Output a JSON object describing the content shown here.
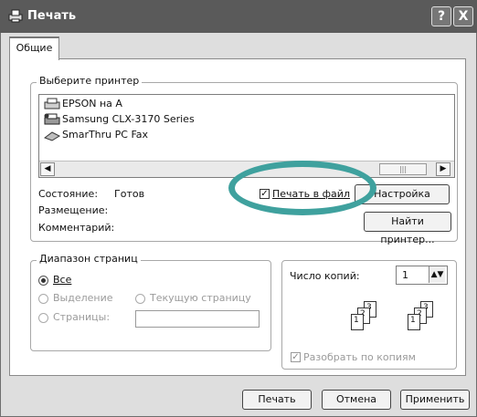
{
  "window": {
    "title": "Печать",
    "help_glyph": "?",
    "close_glyph": "X"
  },
  "tabs": [
    {
      "label": "Общие"
    }
  ],
  "printer": {
    "group_label": "Выберите принтер",
    "items": [
      {
        "name": "EPSON на А",
        "icon": "printer-icon"
      },
      {
        "name": "Samsung CLX-3170 Series",
        "icon": "default-printer-icon"
      },
      {
        "name": "SmarThru PC Fax",
        "icon": "fax-icon"
      }
    ],
    "status_label": "Состояние:",
    "status_value": "Готов",
    "location_label": "Размещение:",
    "comment_label": "Комментарий:",
    "print_to_file_label": "Печать в файл",
    "print_to_file_checked": true,
    "settings_button": "Настройка",
    "find_printer_button": "Найти принтер..."
  },
  "page_range": {
    "group_label": "Диапазон страниц",
    "all_label": "Все",
    "selection_label": "Выделение",
    "current_page_label": "Текущую страницу",
    "pages_label": "Страницы:",
    "pages_value": ""
  },
  "copies": {
    "label": "Число копий:",
    "value": "1",
    "collate_label": "Разобрать по копиям",
    "collate_checked": true,
    "collate_pages": [
      "1",
      "2",
      "3"
    ]
  },
  "footer": {
    "print_button": "Печать",
    "cancel_button": "Отмена",
    "apply_button": "Применить"
  },
  "colors": {
    "annotation": "#3fa19e",
    "titlebar": "#5a5a5a"
  }
}
